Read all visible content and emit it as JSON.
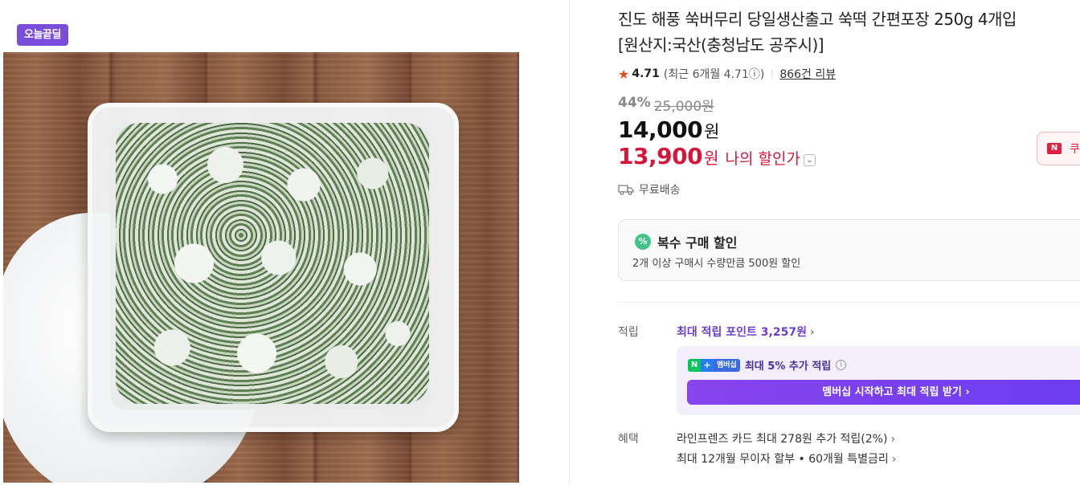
{
  "badge": "오늘끝딜",
  "product": {
    "title_line1": "진도 해풍 쑥버무리 당일생산출고 쑥떡 간편포장 250g 4개입",
    "title_line2": "[원산지:국산(충청남도 공주시)]"
  },
  "rating": {
    "score": "4.71",
    "recent": "(최근 6개월 4.71ⓘ)",
    "reviews": "866건 리뷰"
  },
  "discount": {
    "percent": "44%",
    "original": "25,000원"
  },
  "price": {
    "value": "14,000",
    "unit": "원"
  },
  "my_price": {
    "value": "13,900",
    "unit": "원",
    "label": "나의 할인가",
    "chevron": "⌄"
  },
  "coupon": {
    "badge": "N",
    "label": "쿠"
  },
  "shipping": {
    "label": "무료배송"
  },
  "multi_discount": {
    "icon": "%",
    "title": "복수 구매 할인",
    "desc": "2개 이상 구매시 수량만큼 500원 할인"
  },
  "points": {
    "label": "적립",
    "max_points": "최대 적립 포인트 3,257원",
    "chevron": "›"
  },
  "membership": {
    "badge_n": "N",
    "badge_plus": "+",
    "badge_text": "멤버십",
    "extra": "최대 5% 추가 적립",
    "info": "i",
    "button": "멤버십 시작하고 최대 적립 받기 ›"
  },
  "benefits": {
    "label": "혜택",
    "items": [
      {
        "text": "라인프렌즈 카드 최대 278원 추가 적립(2%)",
        "chevron": "›"
      },
      {
        "text": "최대 12개월 무이자 할부 • 60개월 특별금리",
        "chevron": "›"
      }
    ]
  },
  "colors": {
    "badge": "#7b4ddc",
    "sale_red": "#d6173a",
    "points_purple": "#6b3fd1",
    "star": "#e64a19"
  }
}
